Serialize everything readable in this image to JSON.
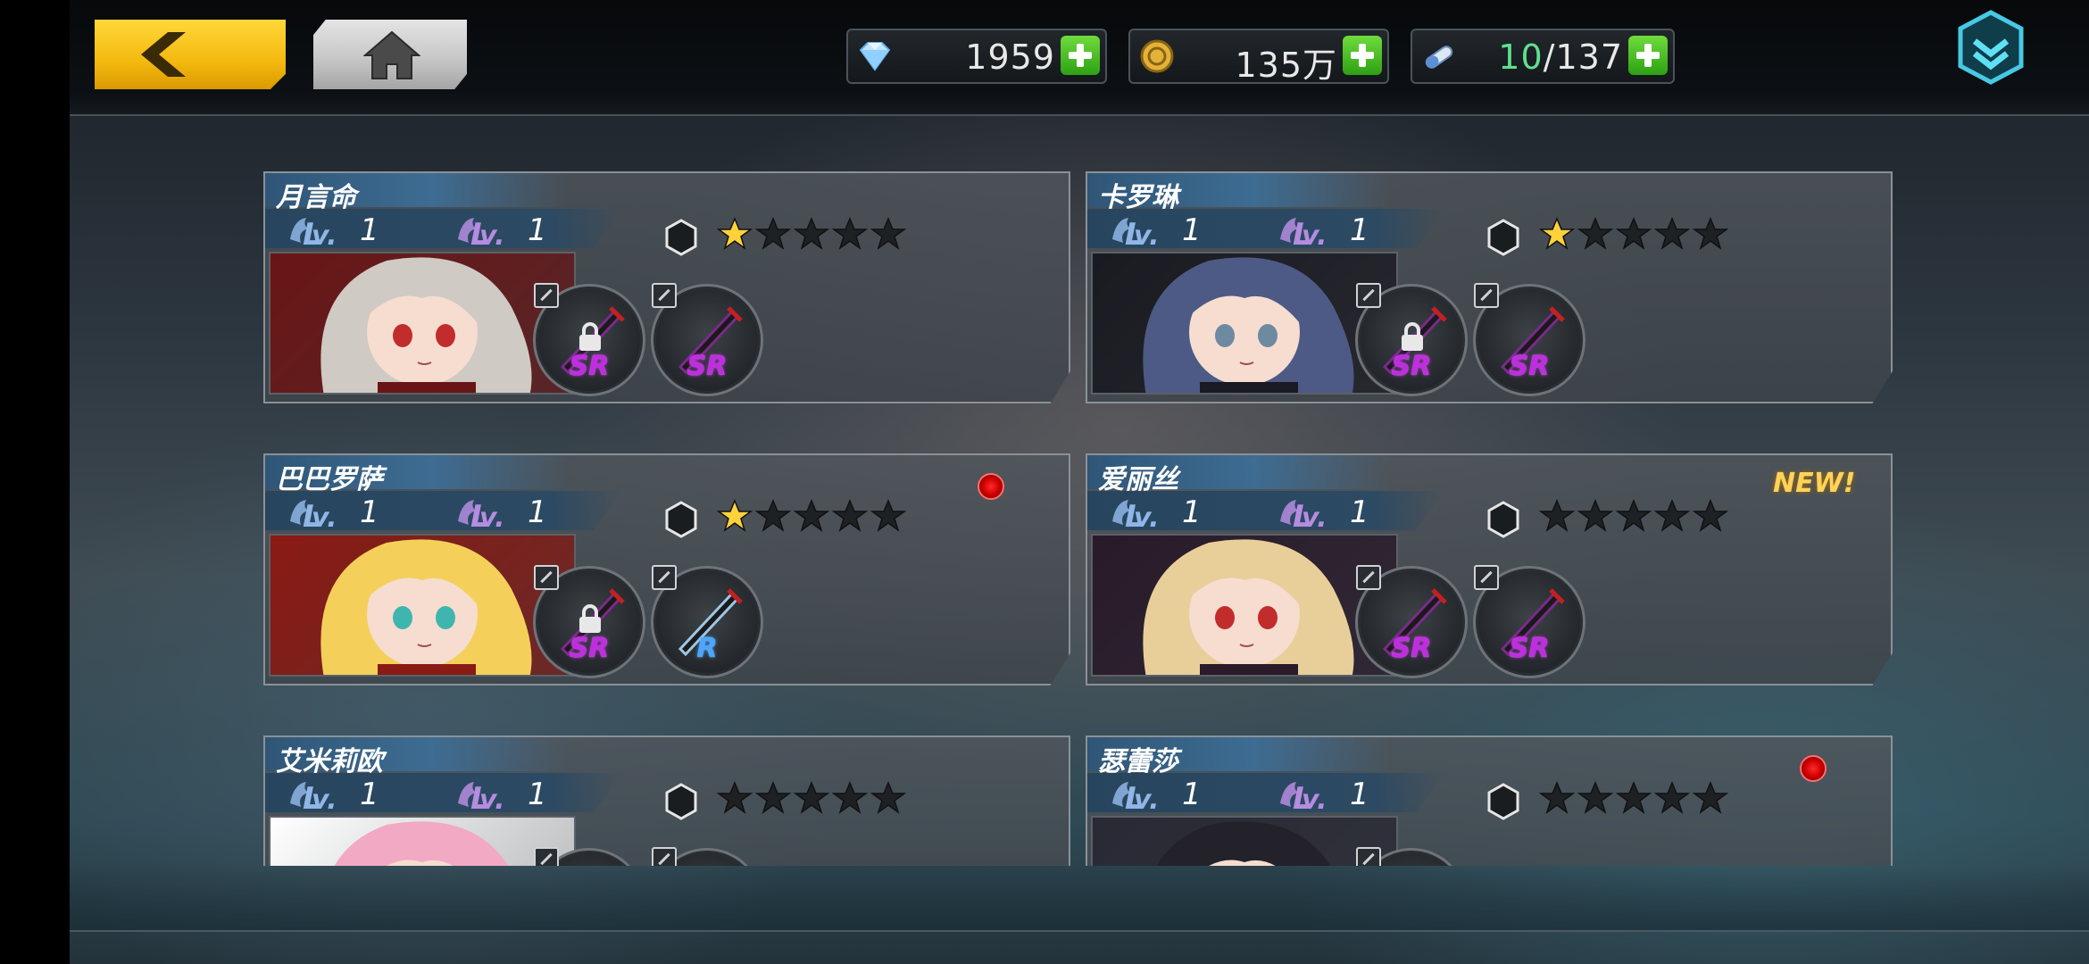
{
  "resources": [
    {
      "icon": "diamond-icon",
      "value": "1959"
    },
    {
      "icon": "coin-icon",
      "value": "135万"
    },
    {
      "icon": "stamina-icon",
      "current": "10",
      "separator": "/",
      "max": "137"
    }
  ],
  "characters": [
    {
      "name": "月言命",
      "lv_char": "1",
      "lv_weapon": "1",
      "stars_filled": 1,
      "stars_total": 5,
      "weapons": [
        {
          "rank": "SR",
          "locked": true
        },
        {
          "rank": "SR",
          "locked": false
        }
      ],
      "badge": "",
      "red_dot": false,
      "hair": "#cfcac3",
      "outfit": "#6a1515",
      "eyes": "#c22c2c"
    },
    {
      "name": "卡罗琳",
      "lv_char": "1",
      "lv_weapon": "1",
      "stars_filled": 1,
      "stars_total": 5,
      "weapons": [
        {
          "rank": "SR",
          "locked": true
        },
        {
          "rank": "SR",
          "locked": false
        }
      ],
      "badge": "",
      "red_dot": false,
      "hair": "#4d5a85",
      "outfit": "#1a1a22",
      "eyes": "#6e8aa0"
    },
    {
      "name": "巴巴罗萨",
      "lv_char": "1",
      "lv_weapon": "1",
      "stars_filled": 1,
      "stars_total": 5,
      "weapons": [
        {
          "rank": "SR",
          "locked": true
        },
        {
          "rank": "R",
          "locked": false
        }
      ],
      "badge": "",
      "red_dot": true,
      "hair": "#f4d05a",
      "outfit": "#8a1a14",
      "eyes": "#3fb5b0"
    },
    {
      "name": "爱丽丝",
      "lv_char": "1",
      "lv_weapon": "1",
      "stars_filled": 0,
      "stars_total": 5,
      "weapons": [
        {
          "rank": "SR",
          "locked": false
        },
        {
          "rank": "SR",
          "locked": false
        }
      ],
      "badge": "NEW!",
      "red_dot": false,
      "hair": "#e8cf9a",
      "outfit": "#2a1a2a",
      "eyes": "#c22c2c"
    },
    {
      "name": "艾米莉欧",
      "lv_char": "1",
      "lv_weapon": "1",
      "stars_filled": 0,
      "stars_total": 5,
      "weapons": [
        {
          "rank": "",
          "locked": false
        },
        {
          "rank": "",
          "locked": false
        }
      ],
      "badge": "",
      "red_dot": false,
      "hair": "#f2a9c4",
      "outfit": "#ffffff",
      "eyes": "#4b8ad6"
    },
    {
      "name": "瑟蕾莎",
      "lv_char": "1",
      "lv_weapon": "1",
      "stars_filled": 0,
      "stars_total": 5,
      "weapons": [
        {
          "rank": "",
          "locked": false
        }
      ],
      "badge": "",
      "red_dot": true,
      "hair": "#23222a",
      "outfit": "#2a2a35",
      "eyes": "#7a6aa5"
    }
  ],
  "colors": {
    "accent_gold": "#f4b910",
    "sr_color": "#c02de0",
    "r_color": "#4aa6ff",
    "star_gold": "#ffd23a"
  }
}
